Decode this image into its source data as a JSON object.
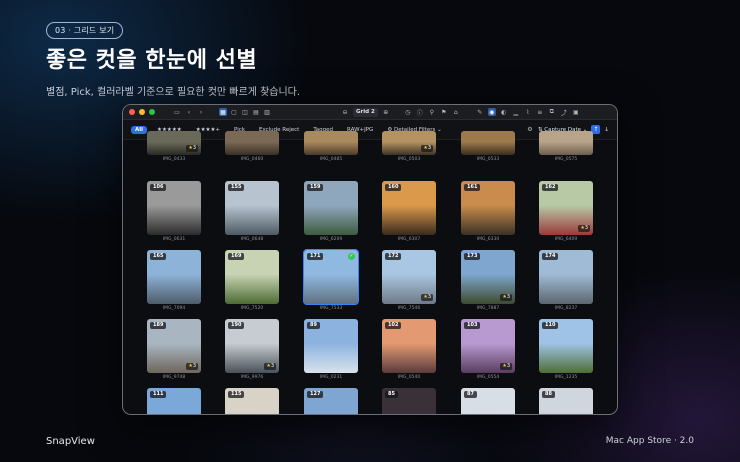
{
  "section_pill": "03 · 그리드 보기",
  "headline": "좋은 컷을 한눈에 선별",
  "subline": "별점, Pick, 컬러라벨 기준으로 필요한 컷만 빠르게 찾습니다.",
  "footer": {
    "brand": "SnapView",
    "store": "Mac App Store · 2.0"
  },
  "toolbar": {
    "grid_label": "Grid 2",
    "colors": {
      "close": "#ff5f57",
      "minimize": "#febc2e",
      "zoom": "#28c840",
      "accent": "#2f6fe0"
    }
  },
  "filters": {
    "all": "All",
    "five_star": "★★★★★",
    "four_star": "★★★★+",
    "pick": "Pick",
    "exclude_reject": "Exclude Reject",
    "tagged": "Tagged",
    "raw_jpg": "RAW+JPG",
    "detailed": "Detailed Filters",
    "sort_label": "Capture Date"
  },
  "rows": [
    [
      {
        "num": "",
        "file": "IMG_0433",
        "star": "3",
        "c1": "#6b6a5a",
        "c2": "#2a2a25"
      },
      {
        "num": "",
        "file": "IMG_0460",
        "star": "",
        "c1": "#7a6a55",
        "c2": "#3a3026"
      },
      {
        "num": "",
        "file": "IMG_0485",
        "star": "",
        "c1": "#a98a5e",
        "c2": "#4b3b2a"
      },
      {
        "num": "",
        "file": "IMG_0503",
        "star": "3",
        "c1": "#b59361",
        "c2": "#3d3226"
      },
      {
        "num": "",
        "file": "IMG_0533",
        "star": "",
        "c1": "#9c7a4b",
        "c2": "#3a2d1f"
      },
      {
        "num": "",
        "file": "IMG_0575",
        "star": "",
        "c1": "#b8a48a",
        "c2": "#6d5e4c"
      }
    ],
    [
      {
        "num": "106",
        "file": "IMG_0631",
        "star": "",
        "c1": "#9a9a9a",
        "c2": "#2b2b2b"
      },
      {
        "num": "155",
        "file": "IMG_0648",
        "star": "",
        "c1": "#b7c3cf",
        "c2": "#4e5a63"
      },
      {
        "num": "159",
        "file": "IMG_6209",
        "star": "",
        "c1": "#8fa7bd",
        "c2": "#3e5b3f"
      },
      {
        "num": "160",
        "file": "IMG_6307",
        "star": "",
        "c1": "#d99a4b",
        "c2": "#3a2a1c"
      },
      {
        "num": "161",
        "file": "IMG_6330",
        "star": "",
        "c1": "#c98c4c",
        "c2": "#3b3125"
      },
      {
        "num": "162",
        "file": "IMG_6409",
        "star": "3",
        "c1": "#b7c9a5",
        "c2": "#9a3b3b"
      }
    ],
    [
      {
        "num": "165",
        "file": "IMG_7094",
        "star": "",
        "c1": "#8db3d8",
        "c2": "#4f5c6a"
      },
      {
        "num": "169",
        "file": "IMG_7520",
        "star": "",
        "c1": "#c7d3b3",
        "c2": "#4e6b34"
      },
      {
        "num": "171",
        "file": "IMG_7533",
        "star": "",
        "c1": "#8fb9e0",
        "c2": "#607080",
        "selected": true,
        "check": true
      },
      {
        "num": "172",
        "file": "IMG_7546",
        "star": "3",
        "c1": "#a9c6e2",
        "c2": "#6e7a86"
      },
      {
        "num": "173",
        "file": "IMG_7887",
        "star": "3",
        "c1": "#7fa6cf",
        "c2": "#3d4a2f"
      },
      {
        "num": "174",
        "file": "IMG_8237",
        "star": "",
        "c1": "#9fbbd6",
        "c2": "#5d666e"
      }
    ],
    [
      {
        "num": "189",
        "file": "IMG_9748",
        "star": "3",
        "c1": "#a9b6c2",
        "c2": "#6e665c"
      },
      {
        "num": "190",
        "file": "IMG_9976",
        "star": "3",
        "c1": "#c6ccd2",
        "c2": "#4a5158"
      },
      {
        "num": "89",
        "file": "IMG_0231",
        "star": "",
        "c1": "#8cb2df",
        "c2": "#d8e2ec"
      },
      {
        "num": "102",
        "file": "IMG_0540",
        "star": "",
        "c1": "#e39a73",
        "c2": "#5a3b3b"
      },
      {
        "num": "103",
        "file": "IMG_0554",
        "star": "3",
        "c1": "#b89ad1",
        "c2": "#5a3d5e"
      },
      {
        "num": "110",
        "file": "IMG_1235",
        "star": "",
        "c1": "#9fc3e6",
        "c2": "#4f6e35"
      }
    ],
    [
      {
        "num": "111",
        "file": "",
        "star": "",
        "c1": "#7aa8d8",
        "c2": "#5d7e9c"
      },
      {
        "num": "115",
        "file": "",
        "star": "",
        "c1": "#d9d2c6",
        "c2": "#8a8074"
      },
      {
        "num": "127",
        "file": "",
        "star": "",
        "c1": "#7fa6d3",
        "c2": "#a8c0d8"
      },
      {
        "num": "85",
        "file": "",
        "star": "",
        "c1": "#3a3038",
        "c2": "#b04f68"
      },
      {
        "num": "87",
        "file": "",
        "star": "",
        "c1": "#d8dee5",
        "c2": "#aeb7c0"
      },
      {
        "num": "88",
        "file": "",
        "star": "",
        "c1": "#cfd6de",
        "c2": "#8f3838"
      }
    ]
  ]
}
